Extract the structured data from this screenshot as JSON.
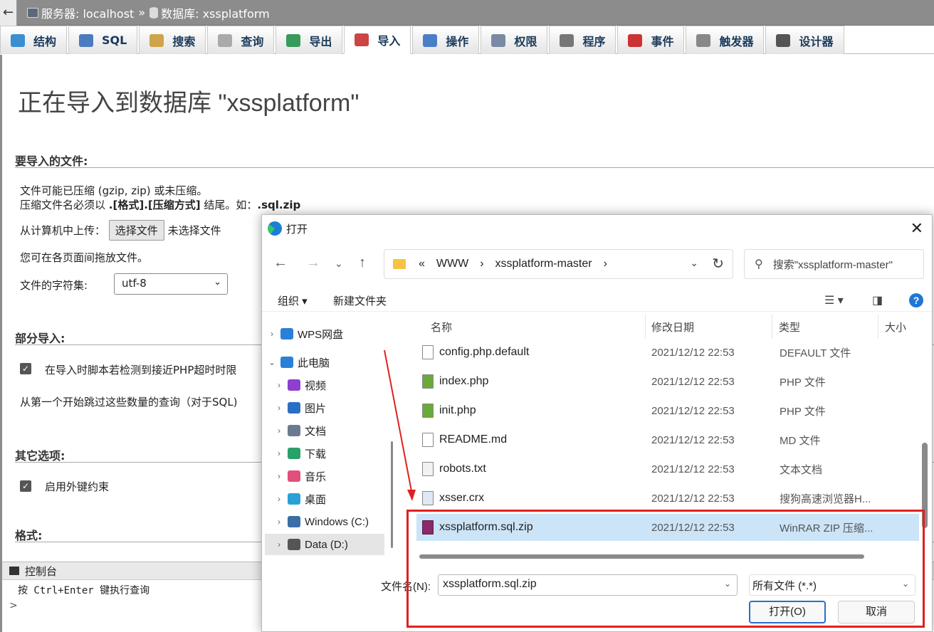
{
  "topbar": {
    "back": "←",
    "server_label": "服务器: localhost",
    "sep": "»",
    "db_label": "数据库: xssplatform"
  },
  "tabs": [
    {
      "label": "结构",
      "color": "#3a8fd1"
    },
    {
      "label": "SQL",
      "color": "#4b7bbf"
    },
    {
      "label": "搜索",
      "color": "#d0a44a"
    },
    {
      "label": "查询",
      "color": "#aaaaaa"
    },
    {
      "label": "导出",
      "color": "#3a9a5a"
    },
    {
      "label": "导入",
      "color": "#cc4444"
    },
    {
      "label": "操作",
      "color": "#4a7ec8"
    },
    {
      "label": "权限",
      "color": "#7a8aa5"
    },
    {
      "label": "程序",
      "color": "#777777"
    },
    {
      "label": "事件",
      "color": "#cc3333"
    },
    {
      "label": "触发器",
      "color": "#888888"
    },
    {
      "label": "设计器",
      "color": "#555555"
    }
  ],
  "page": {
    "title": "正在导入到数据库 \"xssplatform\"",
    "file_section": "要导入的文件:",
    "compress_line1": "文件可能已压缩 (gzip, zip) 或未压缩。",
    "compress_line2_a": "压缩文件名必须以 ",
    "compress_line2_b": ".[格式].[压缩方式]",
    "compress_line2_c": " 结尾。如：",
    "compress_line2_d": ".sql.zip",
    "upload_label": "从计算机中上传：",
    "choose_file": "选择文件",
    "no_file": "未选择文件",
    "drag_hint": "您可在各页面间拖放文件。",
    "charset_label": "文件的字符集:",
    "charset_value": "utf-8",
    "partial_section": "部分导入:",
    "partial_option": "在导入时脚本若检测到接近PHP超时时限",
    "skip_label": "从第一个开始跳过这些数量的查询（对于SQL)",
    "other_section": "其它选项:",
    "fk_option": "启用外键约束",
    "format_section": "格式:"
  },
  "console": {
    "title": "控制台",
    "hint": "按 Ctrl+Enter 键执行查询",
    "prompt": ">"
  },
  "dialog": {
    "title": "打开",
    "close": "✕",
    "path": [
      "«",
      "WWW",
      "›",
      "xssplatform-master",
      "›"
    ],
    "search_placeholder": "搜索\"xssplatform-master\"",
    "organize": "组织 ▾",
    "new_folder": "新建文件夹",
    "nav": [
      {
        "label": "WPS网盘",
        "color": "#2a7fd8",
        "chev": "›"
      },
      {
        "label": "此电脑",
        "color": "#2a7fd8",
        "chev": "⌄"
      },
      {
        "label": "视频",
        "color": "#8e3fd0",
        "chev": "›"
      },
      {
        "label": "图片",
        "color": "#2b6fc4",
        "chev": "›"
      },
      {
        "label": "文档",
        "color": "#6a7a90",
        "chev": "›"
      },
      {
        "label": "下载",
        "color": "#2aa06a",
        "chev": "›"
      },
      {
        "label": "音乐",
        "color": "#e0507a",
        "chev": "›"
      },
      {
        "label": "桌面",
        "color": "#2aa0d8",
        "chev": "›"
      },
      {
        "label": "Windows (C:)",
        "color": "#3a6ea5",
        "chev": "›"
      },
      {
        "label": "Data (D:)",
        "color": "#555555",
        "chev": "›"
      }
    ],
    "columns": {
      "name": "名称",
      "date": "修改日期",
      "type": "类型",
      "size": "大小"
    },
    "files": [
      {
        "name": "config.php.default",
        "date": "2021/12/12 22:53",
        "type": "DEFAULT 文件",
        "icon": "#ffffff"
      },
      {
        "name": "index.php",
        "date": "2021/12/12 22:53",
        "type": "PHP 文件",
        "icon": "#6aaa3a"
      },
      {
        "name": "init.php",
        "date": "2021/12/12 22:53",
        "type": "PHP 文件",
        "icon": "#6aaa3a"
      },
      {
        "name": "README.md",
        "date": "2021/12/12 22:53",
        "type": "MD 文件",
        "icon": "#ffffff"
      },
      {
        "name": "robots.txt",
        "date": "2021/12/12 22:53",
        "type": "文本文档",
        "icon": "#f2f2f2"
      },
      {
        "name": "xsser.crx",
        "date": "2021/12/12 22:53",
        "type": "搜狗高速浏览器H...",
        "icon": "#dfe8f5"
      },
      {
        "name": "xssplatform.sql.zip",
        "date": "2021/12/12 22:53",
        "type": "WinRAR ZIP 压缩...",
        "icon": "#8a2a6a"
      }
    ],
    "filename_label": "文件名(N):",
    "filename_value": "xssplatform.sql.zip",
    "filetype_value": "所有文件 (*.*)",
    "open_button": "打开(O)",
    "cancel_button": "取消"
  },
  "colors": {
    "annotation": "#e02020",
    "selected_row": "#cce4f7"
  }
}
